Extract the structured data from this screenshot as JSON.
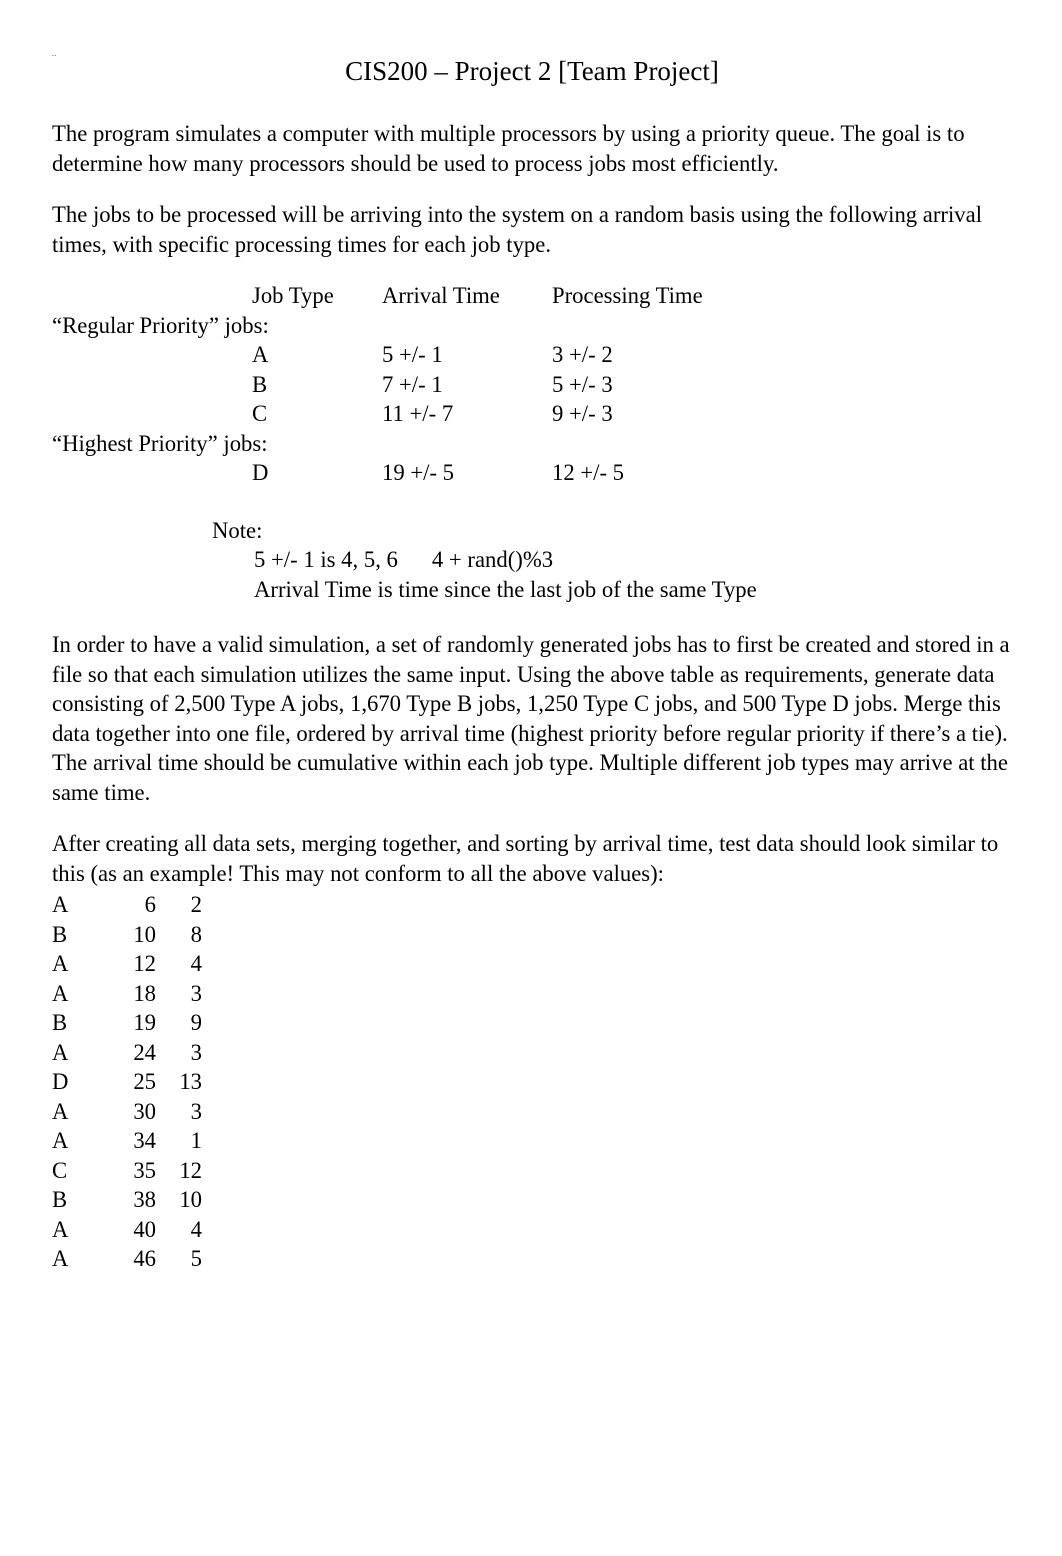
{
  "tiny_mark": "..",
  "title": "CIS200 – Project 2 [Team Project]",
  "para1": "The program simulates a computer with multiple processors by using a priority queue.  The goal is to determine how many processors should be used to process jobs most efficiently.",
  "para2": "The jobs to be processed will be arriving into the system on a random basis using the following arrival times, with specific processing times for each job type.",
  "job_table": {
    "headers": {
      "c2": "Job Type",
      "c3": "Arrival Time",
      "c4": "Processing Time"
    },
    "group1_label": "“Regular Priority” jobs:",
    "group1_rows": [
      {
        "type": "A",
        "arrival": "5 +/- 1",
        "processing": "3 +/- 2"
      },
      {
        "type": "B",
        "arrival": "7 +/- 1",
        "processing": "5 +/- 3"
      },
      {
        "type": "C",
        "arrival": "11 +/- 7",
        "processing": "9 +/- 3"
      }
    ],
    "group2_label": "“Highest Priority” jobs:",
    "group2_rows": [
      {
        "type": "D",
        "arrival": "19 +/- 5",
        "processing": "12 +/- 5"
      }
    ]
  },
  "note": {
    "heading": "Note:",
    "line1": "5 +/- 1 is 4, 5, 6   4 + rand()%3",
    "line2": "Arrival Time is time since the last job of the same Type"
  },
  "para3": "In order to have a valid simulation, a set of randomly generated jobs has to first be created and stored in a file so that each simulation utilizes the same input.  Using the above table as requirements, generate data consisting of 2,500 Type A jobs, 1,670 Type B jobs, 1,250 Type C jobs, and 500 Type D jobs. Merge this data together into one file, ordered by arrival time (highest priority before regular priority if there’s a tie). The arrival time should be cumulative within each job type. Multiple different job types may arrive at the same time.",
  "para4": "After creating all data sets, merging together, and sorting by arrival time, test data should look similar to this (as an example! This may not conform to all the above values):",
  "example_rows": [
    {
      "t": "A",
      "a": "6",
      "p": "2"
    },
    {
      "t": "B",
      "a": "10",
      "p": "8"
    },
    {
      "t": "A",
      "a": "12",
      "p": "4"
    },
    {
      "t": "A",
      "a": "18",
      "p": "3"
    },
    {
      "t": "B",
      "a": "19",
      "p": "9"
    },
    {
      "t": "A",
      "a": "24",
      "p": "3"
    },
    {
      "t": "D",
      "a": "25",
      "p": "13"
    },
    {
      "t": "A",
      "a": "30",
      "p": "3"
    },
    {
      "t": "A",
      "a": "34",
      "p": "1"
    },
    {
      "t": "C",
      "a": "35",
      "p": "12"
    },
    {
      "t": "B",
      "a": "38",
      "p": "10"
    },
    {
      "t": "A",
      "a": "40",
      "p": "4"
    },
    {
      "t": "A",
      "a": "46",
      "p": "5"
    }
  ]
}
